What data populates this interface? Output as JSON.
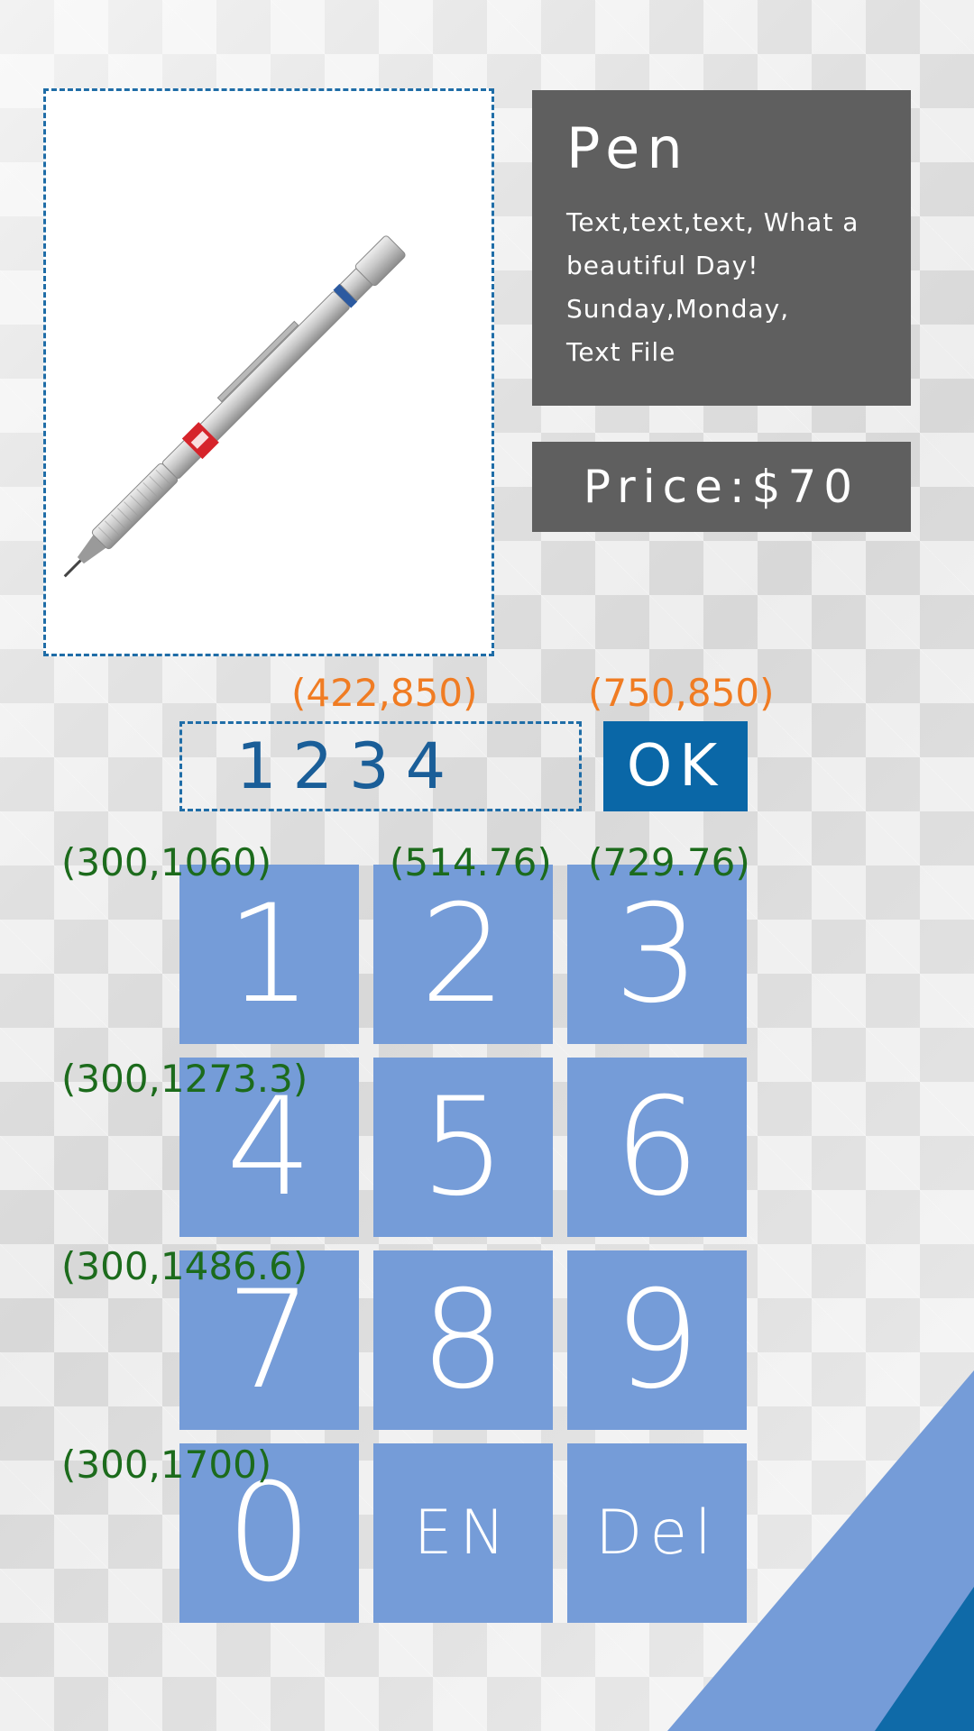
{
  "product": {
    "image_label": "uni SHIFT pen",
    "title": "Pen",
    "description_lines": [
      "Text,text,text,  What  a",
      "beautiful  Day!",
      "Sunday,Monday,",
      "Text  File"
    ],
    "price": "Price:$70"
  },
  "entry": {
    "value": "1234",
    "ok_label": "OK"
  },
  "coordinate_labels": {
    "input": "(422,850)",
    "ok": "(750,850)",
    "key_1": "(300,1060)",
    "key_2": "(514.76)",
    "key_3": "(729.76)",
    "key_4": "(300,1273.3)",
    "key_7": "(300,1486.6)",
    "key_0": "(300,1700)"
  },
  "keypad": {
    "keys": [
      "1",
      "2",
      "3",
      "4",
      "5",
      "6",
      "7",
      "8",
      "9",
      "0",
      "EN",
      "Del"
    ]
  },
  "colors": {
    "accent_blue": "#0a67a7",
    "key_blue": "#759cd8",
    "card_gray": "#5f5f5f",
    "coord_orange": "#f07c23",
    "coord_green": "#1c6b1c"
  }
}
